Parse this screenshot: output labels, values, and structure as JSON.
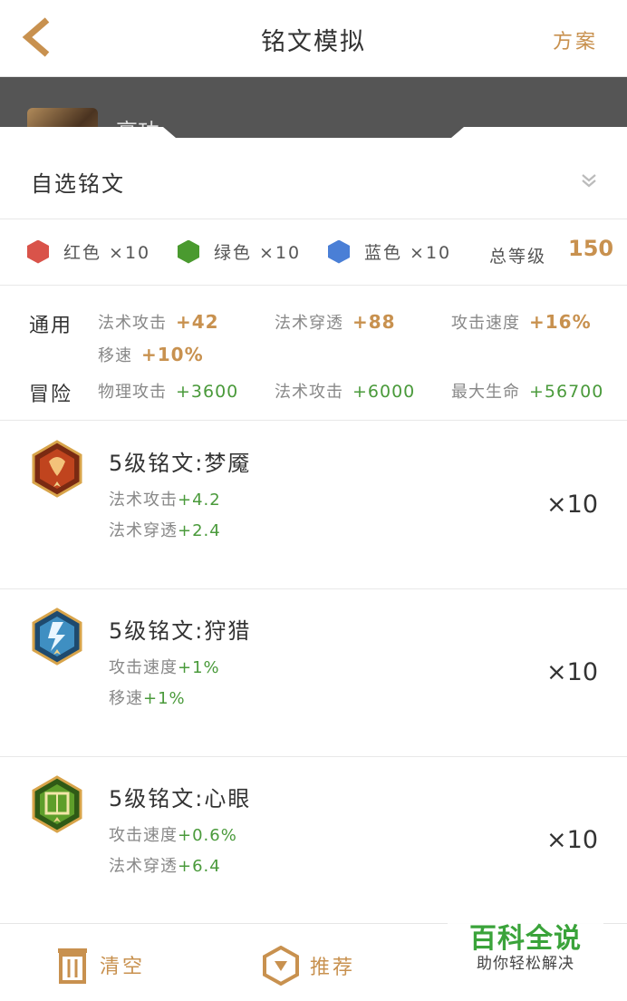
{
  "header": {
    "title": "铭文模拟",
    "plan_label": "方案"
  },
  "hero": {
    "name": "高功"
  },
  "selector": {
    "label": "自选铭文"
  },
  "colors": {
    "red": {
      "label": "红色 ×10",
      "hex": "#d9534a"
    },
    "green": {
      "label": "绿色 ×10",
      "hex": "#4a9a2f"
    },
    "blue": {
      "label": "蓝色 ×10",
      "hex": "#4a7fd6"
    },
    "total_label": "总等级",
    "total_value": "150"
  },
  "stats": {
    "general": {
      "label": "通用",
      "items": [
        {
          "name": "法术攻击",
          "value": "+42"
        },
        {
          "name": "法术穿透",
          "value": "+88"
        },
        {
          "name": "攻击速度",
          "value": "+16%"
        },
        {
          "name": "移速",
          "value": "+10%"
        }
      ]
    },
    "adventure": {
      "label": "冒险",
      "items": [
        {
          "name": "物理攻击",
          "value": "+3600"
        },
        {
          "name": "法术攻击",
          "value": "+6000"
        },
        {
          "name": "最大生命",
          "value": "+56700"
        }
      ]
    }
  },
  "runes": [
    {
      "name": "5级铭文:梦魇",
      "attrs": [
        {
          "name": "法术攻击",
          "value": "+4.2"
        },
        {
          "name": "法术穿透",
          "value": "+2.4"
        }
      ],
      "count": "×10",
      "icon": "red-rune-icon"
    },
    {
      "name": "5级铭文:狩猎",
      "attrs": [
        {
          "name": "攻击速度",
          "value": "+1%"
        },
        {
          "name": "移速",
          "value": "+1%"
        }
      ],
      "count": "×10",
      "icon": "blue-rune-icon"
    },
    {
      "name": "5级铭文:心眼",
      "attrs": [
        {
          "name": "攻击速度",
          "value": "+0.6%"
        },
        {
          "name": "法术穿透",
          "value": "+6.4"
        }
      ],
      "count": "×10",
      "icon": "green-rune-icon"
    }
  ],
  "bottom": {
    "clear_label": "清空",
    "recommend_label": "推荐"
  },
  "watermark": {
    "title": "百科全说",
    "subtitle": "助你轻松解决"
  },
  "accent": "#c8914f"
}
